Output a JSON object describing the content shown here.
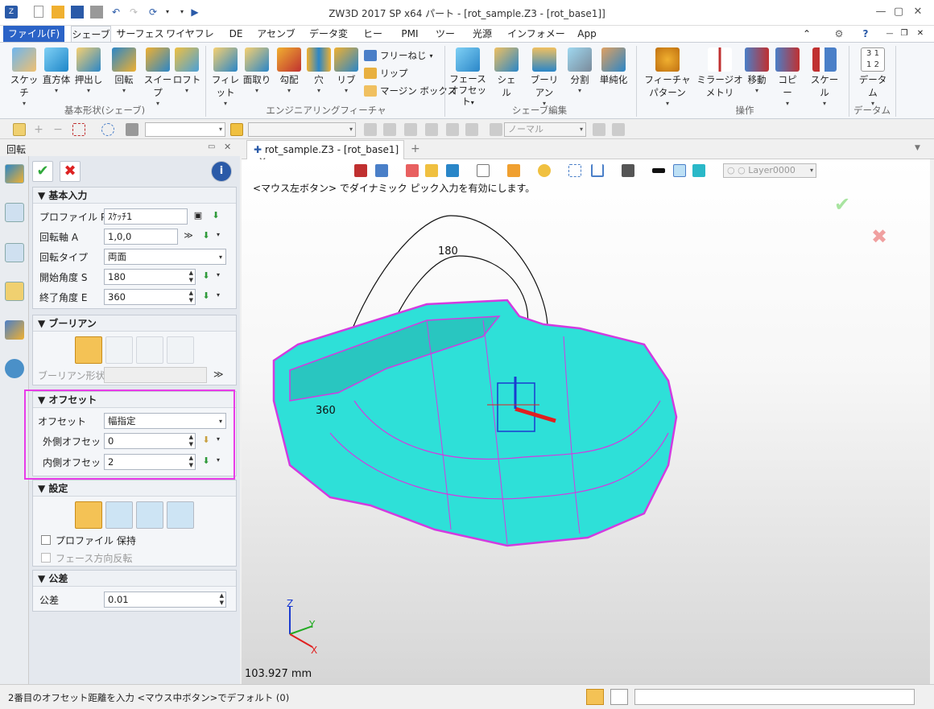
{
  "window": {
    "title": "ZW3D 2017 SP x64      パート - [rot_sample.Z3 - [rot_base1]]"
  },
  "menu": {
    "tabs": [
      "ファイル(F)",
      "シェーブ",
      "サーフェス",
      "ワイヤフレーム",
      "DE",
      "アセンブリ",
      "データ変換",
      "ヒール",
      "PMI",
      "ツール",
      "光源",
      "インフォメーション",
      "App"
    ]
  },
  "ribbon": {
    "basic": [
      "スケッチ",
      "直方体",
      "押出し",
      "回転",
      "スイープ",
      "ロフト"
    ],
    "basic_label": "基本形状(シェーブ)",
    "eng": [
      "フィレット",
      "面取り",
      "勾配",
      "穴",
      "リブ"
    ],
    "eng_small": [
      "フリーねじ",
      "リップ",
      "マージン ボックス"
    ],
    "eng_label": "エンジニアリングフィーチャ",
    "edit": [
      "フェース\nオフセット",
      "シェル",
      "ブーリアン",
      "分割",
      "単純化"
    ],
    "edit_label": "シェーブ編集",
    "ops": [
      "フィーチャパターン",
      "ミラージオメトリ",
      "移動",
      "コピー",
      "スケール"
    ],
    "ops_label": "操作",
    "datum": [
      "データム"
    ],
    "datum_label": "データム"
  },
  "toolbar": {
    "combo2": "ノーマル"
  },
  "panel": {
    "title": "回転",
    "basic": {
      "header": "基本入力",
      "profile_label": "プロファイル P",
      "profile_value": "ｽｹｯﾁ1",
      "axis_label": "回転軸 A",
      "axis_value": "1,0,0",
      "type_label": "回転タイプ",
      "type_value": "両面",
      "start_label": "開始角度 S",
      "start_value": "180",
      "end_label": "終了角度 E",
      "end_value": "360"
    },
    "boolean": {
      "header": "ブーリアン",
      "shape_label": "ブーリアン形状"
    },
    "offset": {
      "header": "オフセット",
      "offset_label": "オフセット",
      "offset_value": "幅指定",
      "outer_label": "外側オフセット",
      "outer_value": "0",
      "inner_label": "内側オフセット",
      "inner_value": "2"
    },
    "settings": {
      "header": "設定",
      "keep_profile": "プロファイル 保持",
      "flip_face": "フェース方向反転"
    },
    "tolerance": {
      "header": "公差",
      "label": "公差",
      "value": "0.01"
    }
  },
  "document": {
    "tab": "rot_sample.Z3 - [rot_base1]"
  },
  "viewport": {
    "layer": "Layer0000",
    "hint": "<マウス左ボタン> でダイナミック ピック入力を有効にします。",
    "dim1": "180",
    "dim2": "360",
    "axis": {
      "z": "Z",
      "y": "Y",
      "x": "X"
    },
    "measure": "103.927 mm",
    "colors": {
      "body": "#2ee0d8",
      "edges": "#d23be0",
      "highlight": "#e83be8"
    }
  },
  "status": {
    "message": "2番目のオフセット距離を入力  <マウス中ボタン>でデフォルト (0)"
  }
}
